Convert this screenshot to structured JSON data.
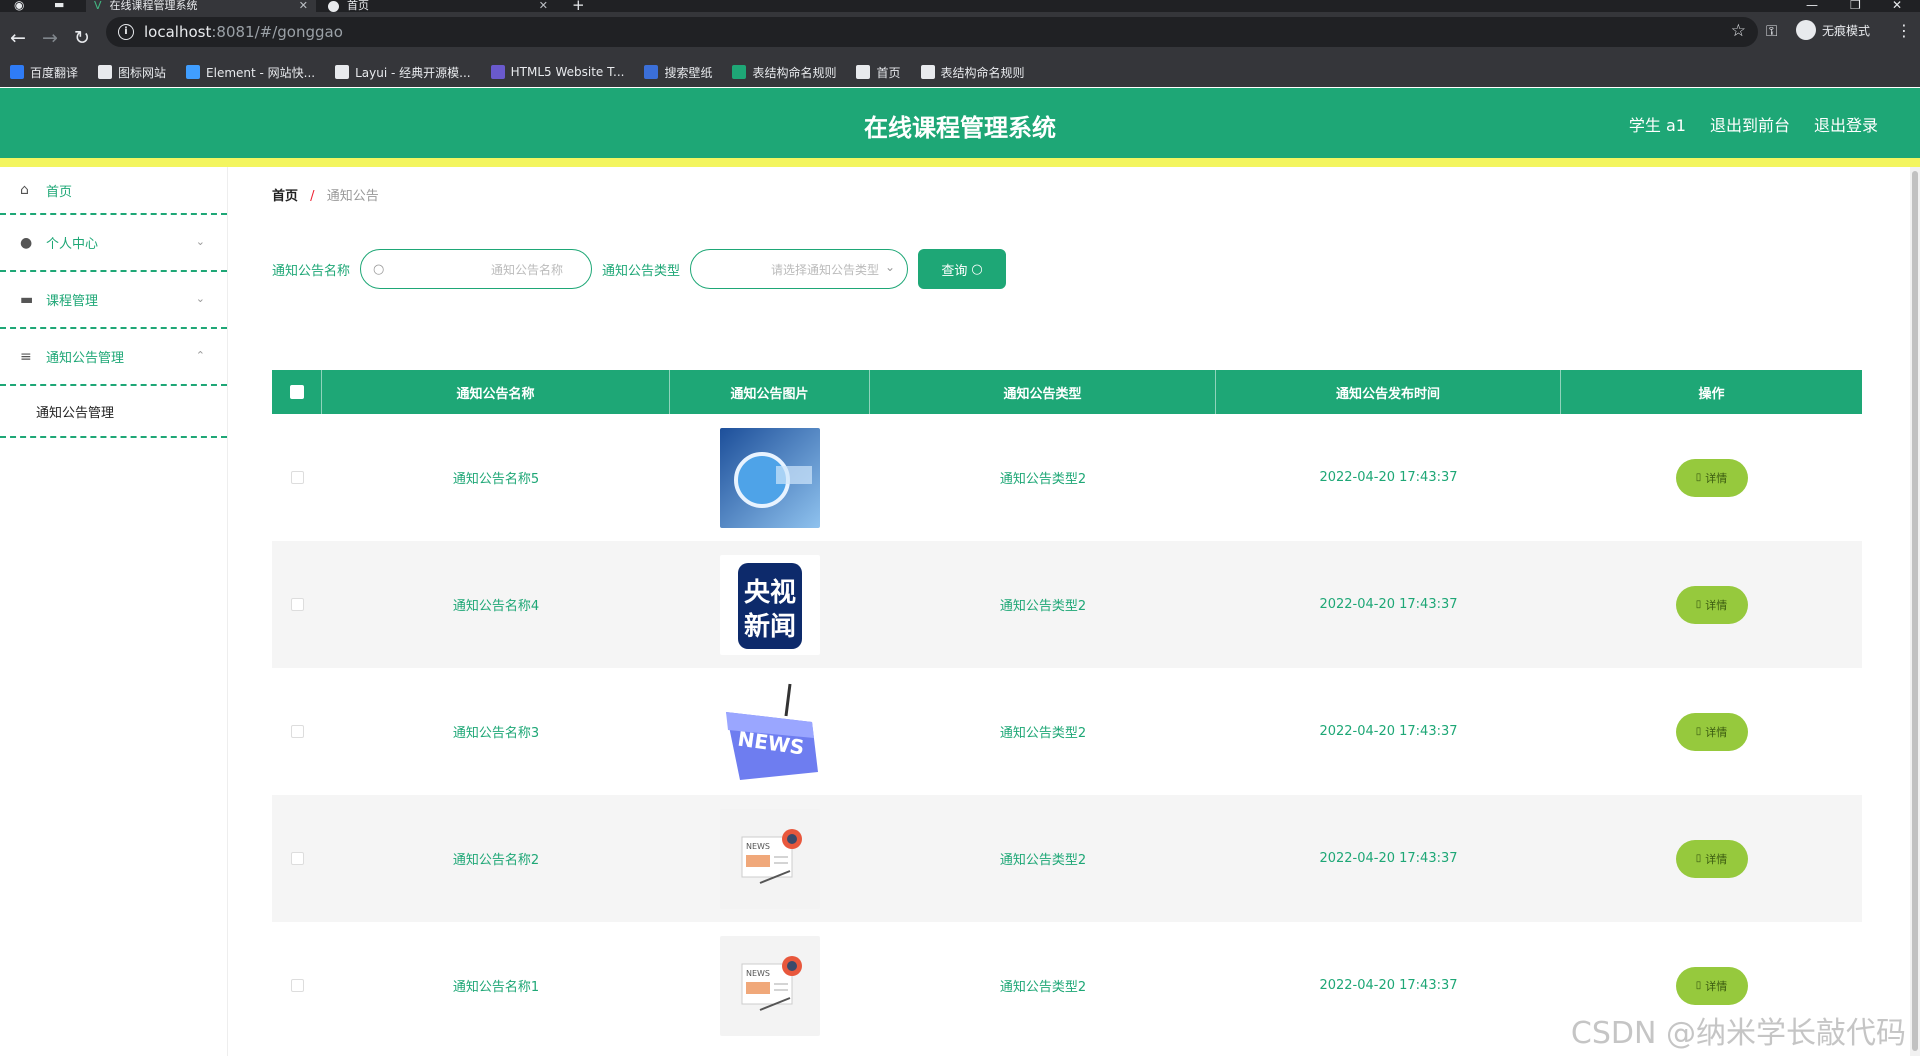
{
  "browser": {
    "tabs": [
      {
        "label": "在线课程管理系统",
        "active": true
      },
      {
        "label": "首页",
        "active": false
      }
    ],
    "url_host": "localhost",
    "url_rest": ":8081/#/gonggao",
    "profile_label": "无痕模式",
    "bookmarks": [
      {
        "label": "百度翻译",
        "color": "#2f7cf6"
      },
      {
        "label": "图标网站",
        "color": "#e8eaed"
      },
      {
        "label": "Element - 网站快...",
        "color": "#409eff"
      },
      {
        "label": "Layui - 经典开源模...",
        "color": "#e8eaed"
      },
      {
        "label": "HTML5 Website T...",
        "color": "#6a5acd"
      },
      {
        "label": "搜索壁纸",
        "color": "#3b6fd8"
      },
      {
        "label": "表结构命名规则",
        "color": "#1ea776"
      },
      {
        "label": "首页",
        "color": "#e8eaed"
      },
      {
        "label": "表结构命名规则",
        "color": "#e8eaed"
      }
    ]
  },
  "app": {
    "title": "在线课程管理系统",
    "user": "学生 a1",
    "exit_front": "退出到前台",
    "logout": "退出登录",
    "accent": "#1ea776"
  },
  "sidebar": {
    "items": [
      {
        "label": "首页",
        "icon": "home-icon"
      },
      {
        "label": "个人中心",
        "icon": "user-icon"
      },
      {
        "label": "课程管理",
        "icon": "briefcase-icon"
      },
      {
        "label": "通知公告管理",
        "icon": "sliders-icon"
      }
    ],
    "sub_item": "通知公告管理"
  },
  "breadcrumb": {
    "home": "首页",
    "sep": "/",
    "current": "通知公告"
  },
  "search": {
    "name_label": "通知公告名称",
    "name_placeholder": "通知公告名称",
    "type_label": "通知公告类型",
    "type_placeholder": "请选择通知公告类型",
    "query_label": "查询"
  },
  "table": {
    "headers": [
      "通知公告名称",
      "通知公告图片",
      "通知公告类型",
      "通知公告发布时间",
      "操作"
    ],
    "detail_label": "详情",
    "rows": [
      {
        "name": "通知公告名称5",
        "type": "通知公告类型2",
        "time": "2022-04-20 17:43:37",
        "image": "news-blue-icon"
      },
      {
        "name": "通知公告名称4",
        "type": "通知公告类型2",
        "time": "2022-04-20 17:43:37",
        "image": "cctv-news-icon"
      },
      {
        "name": "通知公告名称3",
        "type": "通知公告类型2",
        "time": "2022-04-20 17:43:37",
        "image": "news-key-icon"
      },
      {
        "name": "通知公告名称2",
        "type": "通知公告类型2",
        "time": "2022-04-20 17:43:37",
        "image": "newspaper-icon"
      },
      {
        "name": "通知公告名称1",
        "type": "通知公告类型2",
        "time": "2022-04-20 17:43:37",
        "image": "newspaper-icon"
      }
    ]
  },
  "watermark": "CSDN @纳米学长敲代码"
}
